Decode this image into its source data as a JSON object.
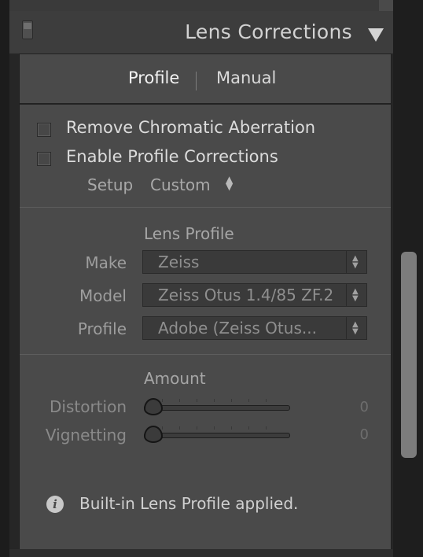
{
  "panel": {
    "title": "Lens Corrections",
    "collapse_icon": "triangle-down-icon",
    "switch_icon": "panel-switch-icon"
  },
  "tabs": [
    {
      "label": "Profile",
      "active": true
    },
    {
      "label": "Manual",
      "active": false
    }
  ],
  "options": {
    "remove_ca": {
      "label": "Remove Chromatic Aberration",
      "checked": false
    },
    "enable_profile": {
      "label": "Enable Profile Corrections",
      "checked": false
    }
  },
  "setup": {
    "label": "Setup",
    "value": "Custom"
  },
  "lens_profile": {
    "title": "Lens Profile",
    "make": {
      "label": "Make",
      "value": "Zeiss"
    },
    "model": {
      "label": "Model",
      "value": "Zeiss Otus 1.4/85 ZF.2"
    },
    "profile": {
      "label": "Profile",
      "value": "Adobe (Zeiss Otus..."
    }
  },
  "amount": {
    "title": "Amount",
    "distortion": {
      "label": "Distortion",
      "value": "0"
    },
    "vignetting": {
      "label": "Vignetting",
      "value": "0"
    }
  },
  "info": {
    "icon": "info-icon",
    "text": "Built-in Lens Profile applied."
  },
  "colors": {
    "panel_bg": "#4a4a4a",
    "header_bg": "#3d3d3d",
    "frame_bg": "#262626",
    "scrollbar": "#7c7c7c"
  }
}
